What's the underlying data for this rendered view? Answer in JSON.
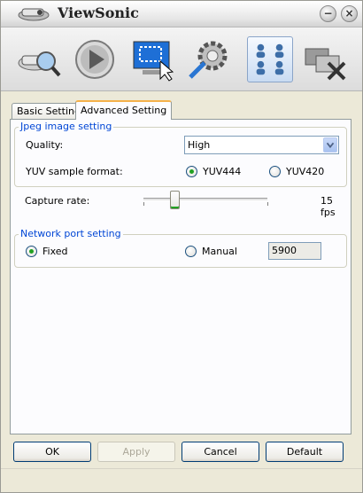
{
  "window": {
    "title": "ViewSonic",
    "minimize_glyph": "−",
    "close_glyph": "×"
  },
  "toolbar": {
    "icons": [
      "projector-search-icon",
      "play-icon",
      "screen-capture-icon",
      "settings-gear-icon",
      "users-grid-icon",
      "disconnect-icon"
    ],
    "active": "users-grid-icon"
  },
  "tabs": [
    {
      "label": "Basic Setting",
      "active": false
    },
    {
      "label": "Advanced Setting",
      "active": true
    }
  ],
  "jpeg": {
    "legend": "Jpeg image setting",
    "quality_label": "Quality:",
    "quality_value": "High",
    "yuv_label": "YUV sample format:",
    "yuv444": "YUV444",
    "yuv420": "YUV420",
    "yuv_selected": "YUV444"
  },
  "capture": {
    "label": "Capture rate:",
    "value_text": "15 fps",
    "slider_fraction": 0.26
  },
  "network": {
    "legend": "Network port setting",
    "fixed": "Fixed",
    "manual": "Manual",
    "selected": "Fixed",
    "port": "5900"
  },
  "buttons": {
    "ok": "OK",
    "apply": "Apply",
    "cancel": "Cancel",
    "default": "Default"
  },
  "colors": {
    "accent": "#0046d5",
    "radio_on": "#21a121",
    "tab_highlight": "#f5b14a"
  }
}
